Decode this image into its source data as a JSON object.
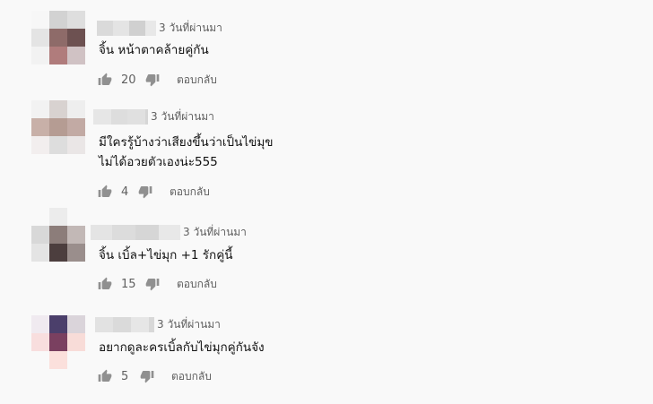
{
  "comments": [
    {
      "time": "3 วันที่ผ่านมา",
      "lines": [
        "จิ้น หน้าตาคล้ายคู่กัน"
      ],
      "likes": "20",
      "reply_label": "ตอบกลับ",
      "avatar_colors": [
        "#f7f7f7",
        "#d2d2d2",
        "#dedede",
        "#e4e4e4",
        "#8e6b69",
        "#6d5151",
        "#f2f2f2",
        "#b07c7c",
        "#d0c2c4"
      ],
      "name_blur": [
        "#dadada",
        "#e4e4e4",
        "#d0d0d0",
        "#e8e8e8"
      ]
    },
    {
      "time": "3 วันที่ผ่านมา",
      "lines": [
        "มีใครรู้บ้างว่าเสียงขึ้นว่าเป็นไข่มุข",
        "ไม่ได้อวยตัวเองน่ะ555"
      ],
      "likes": "4",
      "reply_label": "ตอบกลับ",
      "avatar_colors": [
        "#f2f2f2",
        "#d8d2d0",
        "#eeeeee",
        "#c8b0a8",
        "#b59c93",
        "#c2aaa4",
        "#f2eeee",
        "#dddddd",
        "#eae6e6"
      ],
      "name_blur": [
        "#e6e6e6",
        "#dddddd",
        "#e0e0e0",
        "#d6d6d6"
      ]
    },
    {
      "time": "3 วันที่ผ่านมา",
      "lines": [
        "จิ้น เบิ้ล+ไข่มุก +1 รักคู่นี้"
      ],
      "likes": "15",
      "reply_label": "ตอบกลับ",
      "avatar_colors": [
        "#f9f9f9",
        "#ececec",
        "#f9f9f9",
        "#d8d8d8",
        "#8c7d7a",
        "#c2b8b6",
        "#e4e4e4",
        "#4c3e3e",
        "#9a8e8c"
      ],
      "name_blur": [
        "#e4e4e4",
        "#dcdcdc",
        "#d6d6d6",
        "#e8e8e8"
      ]
    },
    {
      "time": "3 วันที่ผ่านมา",
      "lines": [
        "อยากดูละครเบิ้ลกับไข่มุกคู่กันจัง"
      ],
      "likes": "5",
      "reply_label": "ตอบกลับ",
      "avatar_colors": [
        "#f0eaf0",
        "#4b3f6b",
        "#dad4da",
        "#f8dede",
        "#7a4060",
        "#f8dcd8",
        "#f9f9f9",
        "#fbe0dc",
        "#f9f9f9"
      ],
      "name_blur": [
        "#e2e2e2",
        "#dadada",
        "#e6e6e6",
        "#d8d8d8"
      ]
    }
  ]
}
